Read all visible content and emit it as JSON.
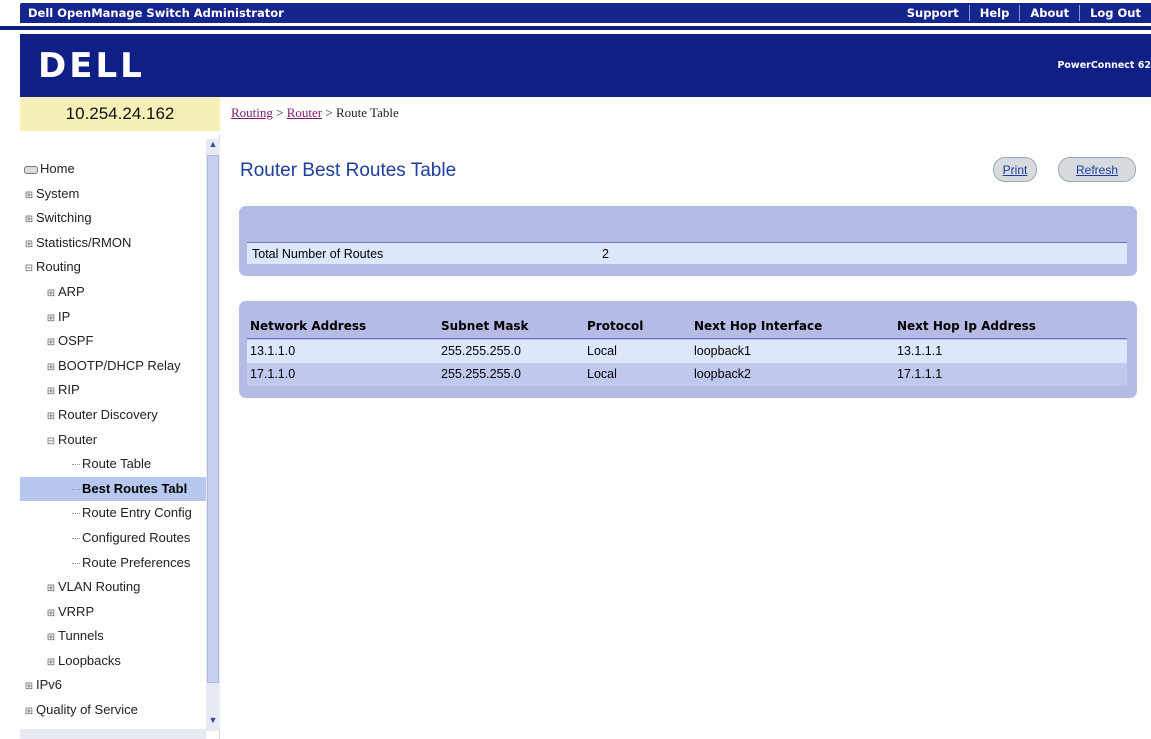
{
  "app": {
    "title": "Dell OpenManage Switch Administrator",
    "links": [
      "Support",
      "Help",
      "About",
      "Log Out"
    ]
  },
  "brand": {
    "logo": "DELL",
    "product": "PowerConnect 62"
  },
  "device": {
    "ip": "10.254.24.162"
  },
  "nav": {
    "items": [
      {
        "label": "Home",
        "level": 0,
        "icon": "home-icon"
      },
      {
        "label": "System",
        "level": 0,
        "expander": "+"
      },
      {
        "label": "Switching",
        "level": 0,
        "expander": "+"
      },
      {
        "label": "Statistics/RMON",
        "level": 0,
        "expander": "+"
      },
      {
        "label": "Routing",
        "level": 0,
        "expander": "−"
      },
      {
        "label": "ARP",
        "level": 1,
        "expander": "+"
      },
      {
        "label": "IP",
        "level": 1,
        "expander": "+"
      },
      {
        "label": "OSPF",
        "level": 1,
        "expander": "+"
      },
      {
        "label": "BOOTP/DHCP Relay",
        "level": 1,
        "expander": "+"
      },
      {
        "label": "RIP",
        "level": 1,
        "expander": "+"
      },
      {
        "label": "Router Discovery",
        "level": 1,
        "expander": "+"
      },
      {
        "label": "Router",
        "level": 1,
        "expander": "−"
      },
      {
        "label": "Route Table",
        "level": 2
      },
      {
        "label": "Best Routes Tabl",
        "level": 2,
        "active": true
      },
      {
        "label": "Route Entry Config",
        "level": 2
      },
      {
        "label": "Configured Routes",
        "level": 2
      },
      {
        "label": "Route Preferences",
        "level": 2
      },
      {
        "label": "VLAN Routing",
        "level": 1,
        "expander": "+"
      },
      {
        "label": "VRRP",
        "level": 1,
        "expander": "+"
      },
      {
        "label": "Tunnels",
        "level": 1,
        "expander": "+"
      },
      {
        "label": "Loopbacks",
        "level": 1,
        "expander": "+"
      },
      {
        "label": "IPv6",
        "level": 0,
        "expander": "+"
      },
      {
        "label": "Quality of Service",
        "level": 0,
        "expander": "+"
      }
    ]
  },
  "breadcrumb": {
    "part1": "Routing",
    "sep": " > ",
    "part2": "Router",
    "part3": "Route Table"
  },
  "page": {
    "title": "Router Best Routes Table",
    "print_label": "Print",
    "refresh_label": "Refresh"
  },
  "summary": {
    "label": "Total Number of Routes",
    "value": "2"
  },
  "table": {
    "columns": [
      "Network Address",
      "Subnet Mask",
      "Protocol",
      "Next Hop Interface",
      "Next Hop Ip Address"
    ],
    "rows": [
      [
        "13.1.1.0",
        "255.255.255.0",
        "Local",
        "loopback1",
        "13.1.1.1"
      ],
      [
        "17.1.1.0",
        "255.255.255.0",
        "Local",
        "loopback2",
        "17.1.1.1"
      ]
    ]
  }
}
